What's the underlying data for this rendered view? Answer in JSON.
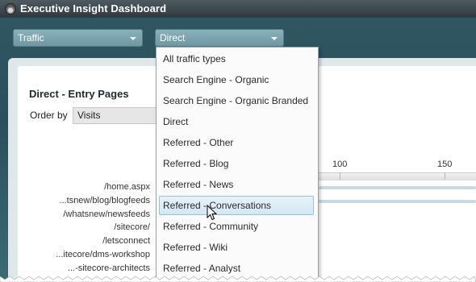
{
  "window": {
    "title": "Executive Insight Dashboard",
    "icon": "dashboard-gauge-icon"
  },
  "filters": {
    "category": {
      "value": "Traffic",
      "icon": "chevron-down-icon"
    },
    "traffic_type": {
      "value": "Direct",
      "icon": "chevron-down-icon"
    }
  },
  "panel": {
    "title": "Direct - Entry Pages",
    "order_by": {
      "label": "Order by",
      "value": "Visits"
    }
  },
  "chart_data": {
    "type": "bar",
    "x_ticks": [
      "100",
      "150"
    ],
    "categories": [
      "/home.aspx",
      "...tsnew/blog/blogfeeds",
      "/whatsnew/newsfeeds",
      "/sitecore/",
      "/letsconnect",
      "...itecore/dms-workshop",
      "...-sitecore-architects"
    ],
    "values": [
      195,
      170,
      null,
      null,
      null,
      null,
      null
    ]
  },
  "dropdown": {
    "options": [
      "All traffic types",
      "Search Engine - Organic",
      "Search Engine - Organic Branded",
      "Direct",
      "Referred - Other",
      "Referred - Blog",
      "Referred - News",
      "Referred - Conversations",
      "Referred - Community",
      "Referred - Wiki",
      "Referred - Analyst"
    ],
    "hovered": "Referred - Conversations"
  },
  "colors": {
    "accent": "#2f5661",
    "title_bar": "#3a464c",
    "hover": "#d3e7f3"
  }
}
